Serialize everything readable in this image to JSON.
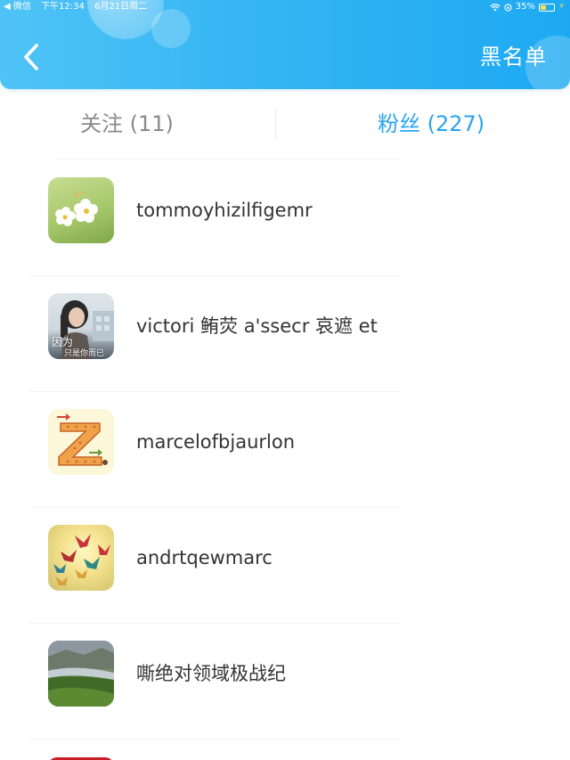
{
  "status_bar": {
    "carrier": "◀ 微信",
    "time": "下午12:34",
    "date": "6月21日周二",
    "battery": "35%",
    "battery_level": 0.35
  },
  "header": {
    "blacklist_label": "黑名单"
  },
  "tabs": [
    {
      "label": "关注 (11)",
      "active": false
    },
    {
      "label": "粉丝 (227)",
      "active": true
    }
  ],
  "fans": [
    {
      "name": "tommoyhizilfigemr",
      "avatar": "white-blossom"
    },
    {
      "name": "victori 鲔荧 a'ssecr 哀遮 et",
      "avatar": "person-photo",
      "avatar_caption": [
        "因为",
        "只是你而已"
      ]
    },
    {
      "name": "marcelofbjaurlon",
      "avatar": "letter-z"
    },
    {
      "name": "andrtqewmarc",
      "avatar": "paper-cranes"
    },
    {
      "name": "嘶绝对领域极战纪",
      "avatar": "river-landscape"
    }
  ],
  "colors": {
    "header_start": "#4fc3f7",
    "header_end": "#1da9f2",
    "tab_active": "#2aa4f0",
    "tab_inactive": "#8a8a8a",
    "name_text": "#333333"
  }
}
